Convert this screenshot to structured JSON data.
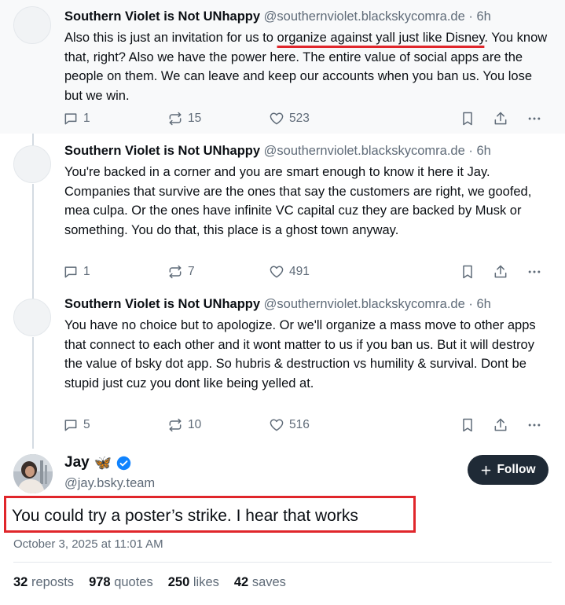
{
  "replies": [
    {
      "author": "Southern Violet is Not UNhappy",
      "handle": "@southernviolet.blackskycomra.de",
      "time": "· 6h",
      "text_before": "Also this is just an invitation for us to ",
      "text_underlined": "organize against yall just like Disney",
      "text_after": ". You know that, right? Also we have the power here. The entire value of social apps are the people on them. We can leave and keep our accounts when you ban us. You lose but we win.",
      "replies_count": "1",
      "reposts_count": "15",
      "likes_count": "523"
    },
    {
      "author": "Southern Violet is Not UNhappy",
      "handle": "@southernviolet.blackskycomra.de",
      "time": "· 6h",
      "text": "You're backed in a corner and you are smart enough to know it here it Jay. Companies that survive are the ones that say the customers are right, we goofed, mea culpa. Or the ones have infinite VC capital cuz they are backed by Musk or something. You do that, this place is a ghost town anyway.",
      "replies_count": "1",
      "reposts_count": "7",
      "likes_count": "491"
    },
    {
      "author": "Southern Violet is Not UNhappy",
      "handle": "@southernviolet.blackskycomra.de",
      "time": "· 6h",
      "text": "You have no choice but to apologize. Or we'll organize a mass move to other apps that connect to each other and it wont matter to us if you ban us. But it will destroy the value of bsky dot app. So hubris & destruction vs humility & survival. Dont be stupid just cuz you dont like being yelled at.",
      "replies_count": "5",
      "reposts_count": "10",
      "likes_count": "516"
    }
  ],
  "main_post": {
    "author": "Jay",
    "emoji": "🦋",
    "handle": "@jay.bsky.team",
    "follow_label": "Follow",
    "text": "You could try a poster’s strike. I hear that works",
    "date": "October 3, 2025 at 11:01 AM",
    "stats": {
      "reposts_value": "32",
      "reposts_label": "reposts",
      "quotes_value": "978",
      "quotes_label": "quotes",
      "likes_value": "250",
      "likes_label": "likes",
      "saves_value": "42",
      "saves_label": "saves"
    }
  },
  "colors": {
    "highlight_red": "#e0262b",
    "follow_button": "#1f2a36",
    "verified_blue": "#1083fe",
    "muted_text": "#5f6b78"
  },
  "icons": [
    "reply-icon",
    "repost-icon",
    "like-icon",
    "bookmark-icon",
    "share-icon",
    "more-icon",
    "verified-badge-icon",
    "plus-icon"
  ]
}
